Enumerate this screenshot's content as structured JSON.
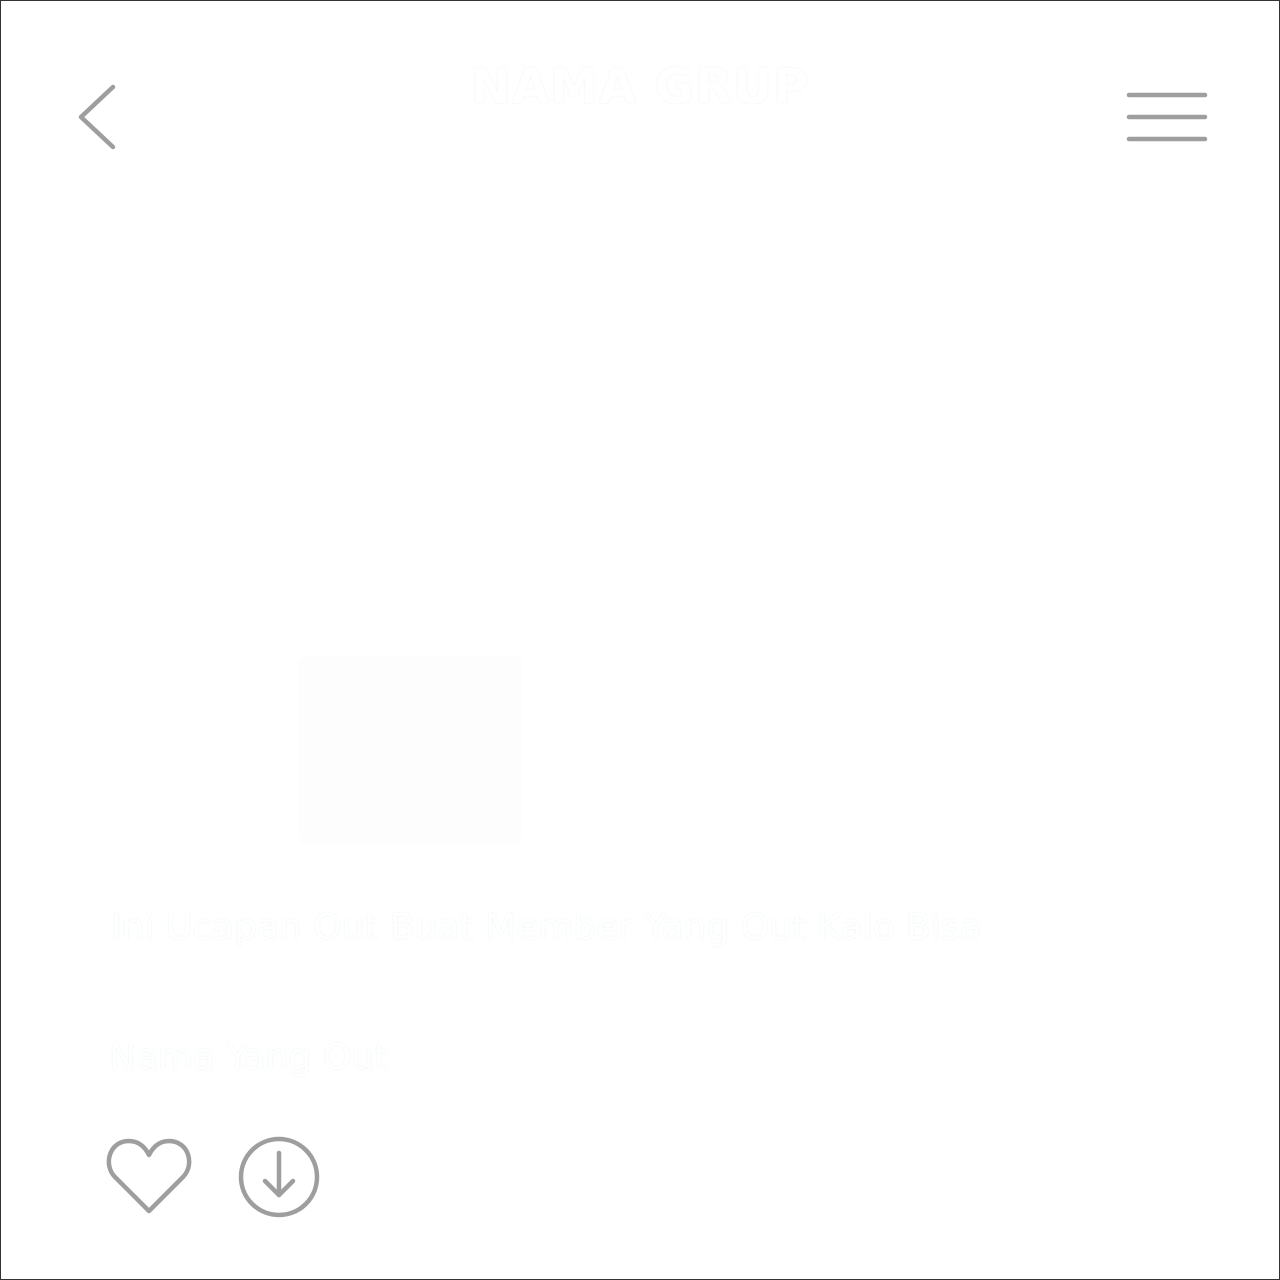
{
  "header": {
    "title": "NAMA GRUP",
    "back_icon": "chevron-left-icon",
    "menu_icon": "hamburger-menu-icon"
  },
  "post": {
    "message": "Ini Ucapan Out Buat Member Yang Out Kalo Bisa",
    "member_name": "Nama Yang Out"
  },
  "actions": {
    "like_icon": "heart-icon",
    "download_icon": "download-circle-icon"
  },
  "colors": {
    "icon": "#9e9e9e",
    "background": "#ffffff",
    "border": "#333333"
  }
}
